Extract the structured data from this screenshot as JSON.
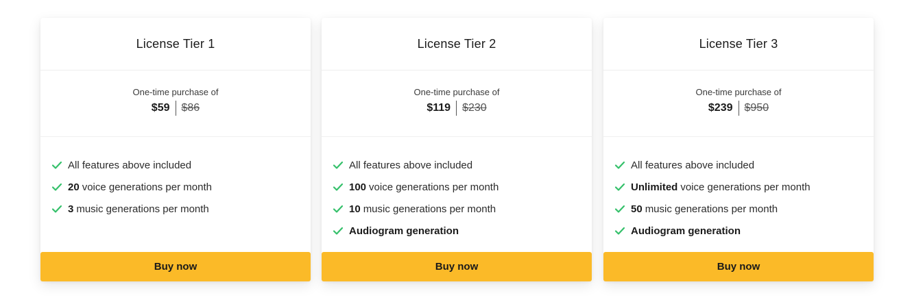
{
  "colors": {
    "accent": "#fbba28",
    "check": "#34c06a",
    "text": "#1f1f1f"
  },
  "tiers": [
    {
      "title": "License Tier 1",
      "price_caption": "One-time purchase of",
      "price": "$59",
      "original_price": "$86",
      "features": [
        {
          "strong": "",
          "text": "All features above included",
          "icon": "check-icon"
        },
        {
          "strong": "20",
          "text": "voice generations per month",
          "icon": "check-icon"
        },
        {
          "strong": "3",
          "text": "music generations per month",
          "icon": "check-icon"
        }
      ],
      "button_label": "Buy now"
    },
    {
      "title": "License Tier 2",
      "price_caption": "One-time purchase of",
      "price": "$119",
      "original_price": "$230",
      "features": [
        {
          "strong": "",
          "text": "All features above included",
          "icon": "check-icon"
        },
        {
          "strong": "100",
          "text": "voice generations per month",
          "icon": "check-icon"
        },
        {
          "strong": "10",
          "text": "music generations per month",
          "icon": "check-icon"
        },
        {
          "strong": "Audiogram generation",
          "text": "",
          "icon": "check-icon"
        }
      ],
      "button_label": "Buy now"
    },
    {
      "title": "License Tier 3",
      "price_caption": "One-time purchase of",
      "price": "$239",
      "original_price": "$950",
      "features": [
        {
          "strong": "",
          "text": "All features above included",
          "icon": "check-icon"
        },
        {
          "strong": "Unlimited",
          "text": "voice generations per month",
          "icon": "check-icon"
        },
        {
          "strong": "50",
          "text": "music generations per month",
          "icon": "check-icon"
        },
        {
          "strong": "Audiogram generation",
          "text": "",
          "icon": "check-icon"
        }
      ],
      "button_label": "Buy now"
    }
  ]
}
